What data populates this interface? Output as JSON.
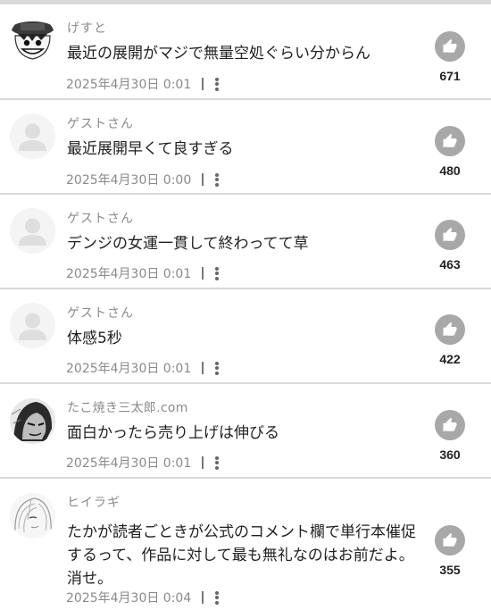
{
  "comments": [
    {
      "user": "げすと",
      "text": "最近の展開がマジで無量空処ぐらい分からん",
      "date": "2025年4月30日 0:01",
      "likes": "671",
      "avatar": "luffy-avatar"
    },
    {
      "user": "ゲストさん",
      "text": "最近展開早くて良すぎる",
      "date": "2025年4月30日 0:00",
      "likes": "480",
      "avatar": "default-avatar"
    },
    {
      "user": "ゲストさん",
      "text": "デンジの女運一貫して終わってて草",
      "date": "2025年4月30日 0:01",
      "likes": "463",
      "avatar": "default-avatar"
    },
    {
      "user": "ゲストさん",
      "text": "体感5秒",
      "date": "2025年4月30日 0:01",
      "likes": "422",
      "avatar": "default-avatar"
    },
    {
      "user": "たこ焼き三太郎.com",
      "text": "面白かったら売り上げは伸びる",
      "date": "2025年4月30日 0:01",
      "likes": "360",
      "avatar": "hooded-character-avatar"
    },
    {
      "user": "ヒイラギ",
      "text": "たかが読者ごときが公式のコメント欄で単行本催促するって、作品に対して最も無礼なのはお前だよ。消せ。",
      "date": "2025年4月30日 0:04",
      "likes": "355",
      "avatar": "anime-girl-avatar"
    }
  ]
}
